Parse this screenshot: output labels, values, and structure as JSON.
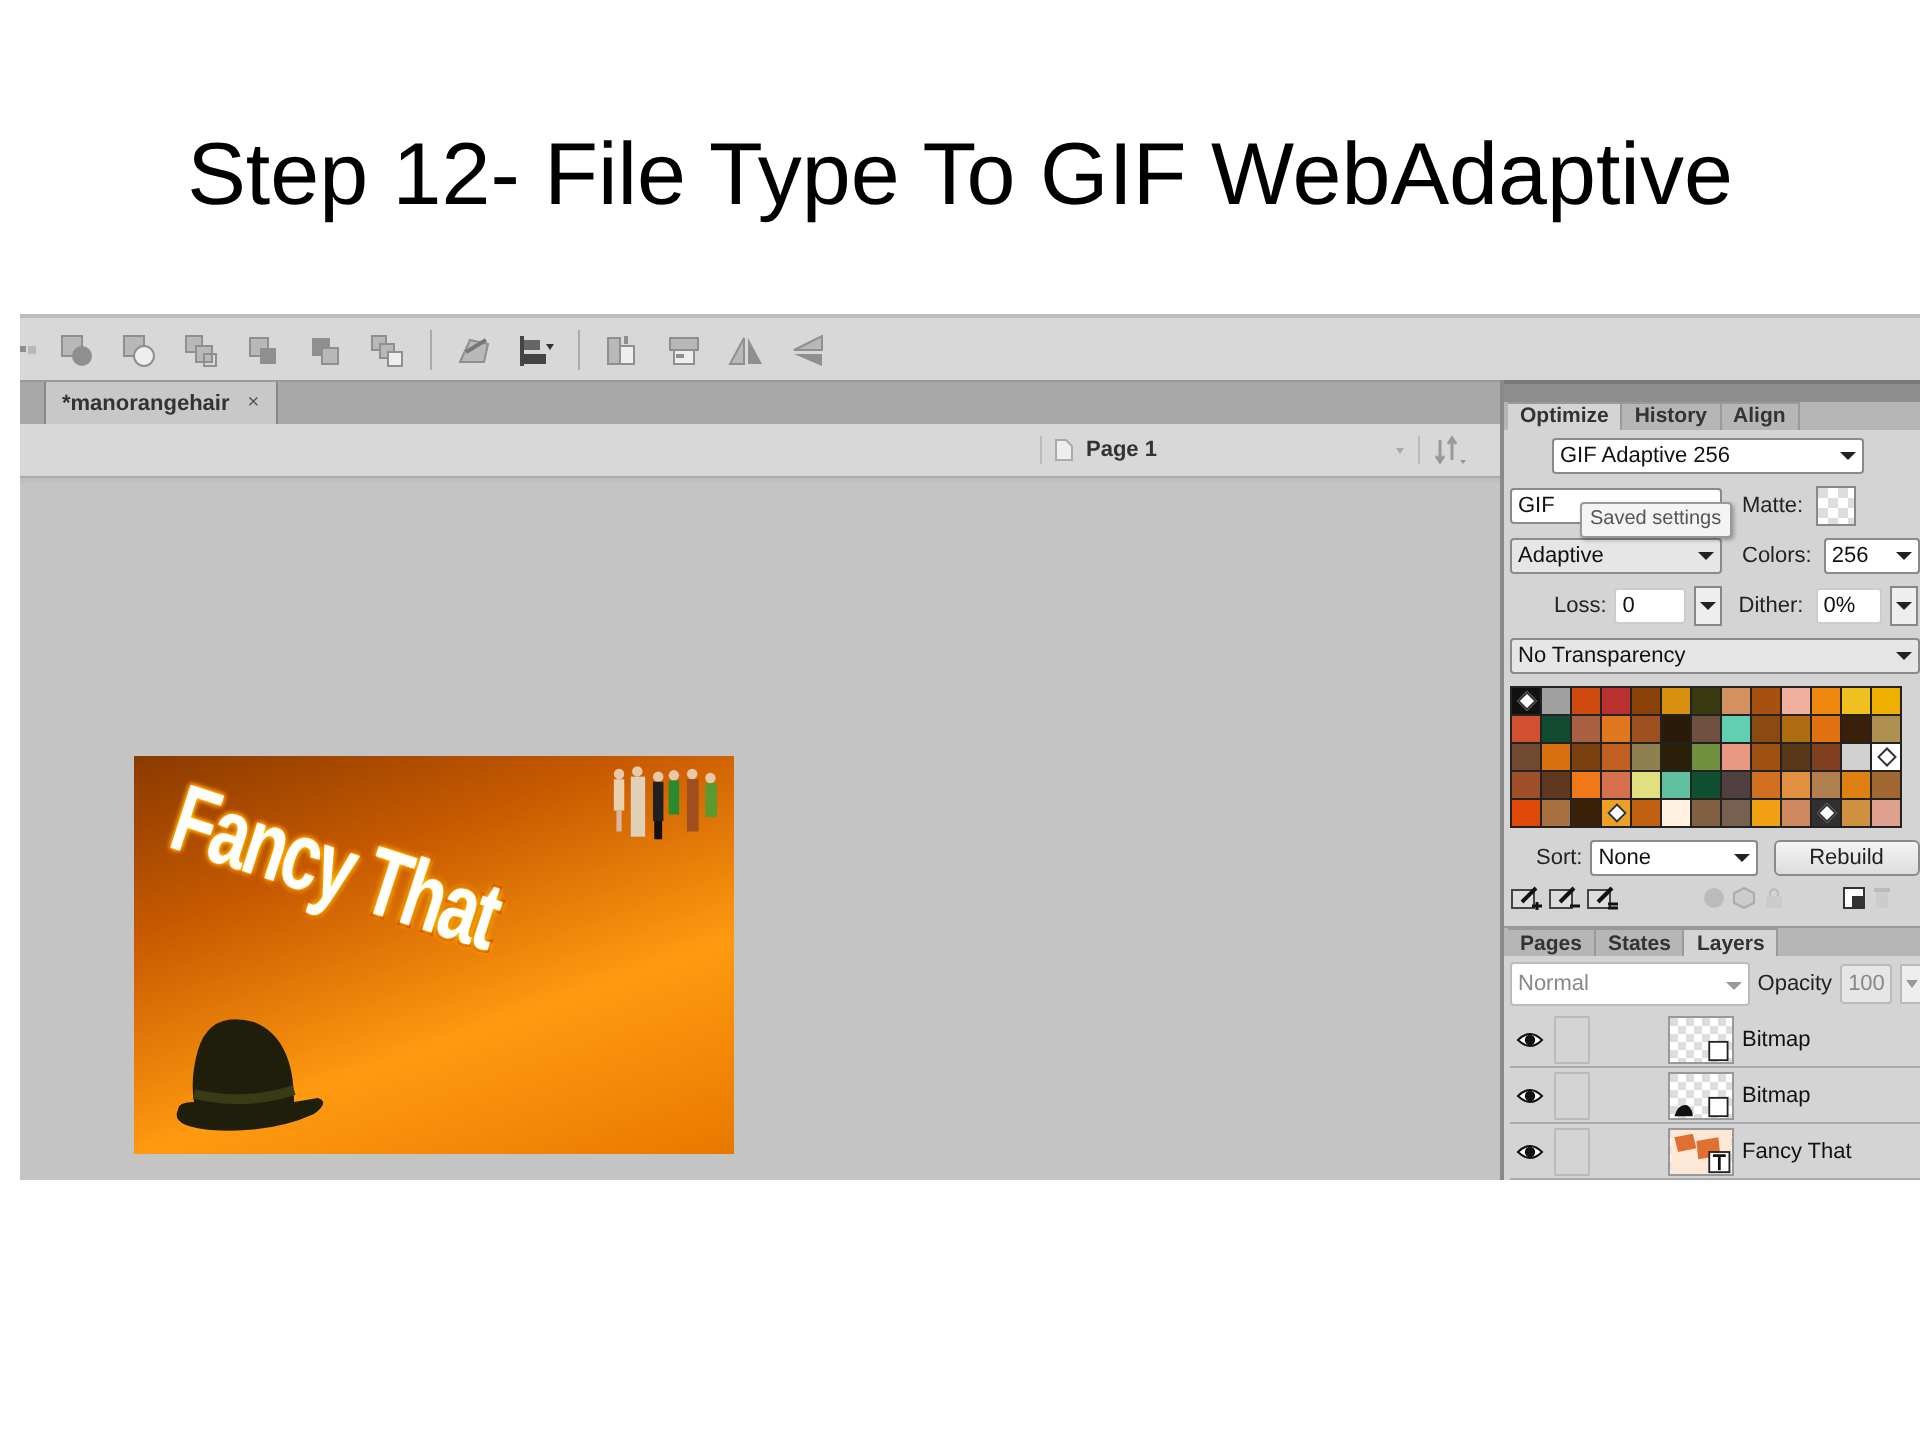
{
  "slide_title": "Step 12- File Type To GIF WebAdaptive",
  "document_tabs": [
    {
      "label": "*manorangehair",
      "close": "×",
      "selected": true
    }
  ],
  "page_bar": {
    "page": "Page 1"
  },
  "canvas": {
    "headline": "Fancy That"
  },
  "optimize_panel": {
    "tabs": [
      {
        "label": "Optimize",
        "selected": true
      },
      {
        "label": "History",
        "selected": false
      },
      {
        "label": "Align",
        "selected": false
      }
    ],
    "preset": "GIF Adaptive 256",
    "format": "GIF",
    "matte_label": "Matte:",
    "tooltip": "Saved settings",
    "palette_type": "Adaptive",
    "colors_label": "Colors:",
    "colors_value": "256",
    "loss_label": "Loss:",
    "loss_value": "0",
    "dither_label": "Dither:",
    "dither_value": "0%",
    "transparency": "No Transparency",
    "swatches": [
      [
        {
          "color": "#111111",
          "marked": true
        },
        {
          "color": "#a0a0a0",
          "marked": false
        },
        {
          "color": "#d04a10",
          "marked": false
        },
        {
          "color": "#b83030",
          "marked": false
        },
        {
          "color": "#8a4208",
          "marked": false
        },
        {
          "color": "#d89010",
          "marked": false
        },
        {
          "color": "#3a3a10",
          "marked": false
        },
        {
          "color": "#d49060",
          "marked": false
        },
        {
          "color": "#a85010",
          "marked": false
        },
        {
          "color": "#f0b0a0",
          "marked": false
        },
        {
          "color": "#f08810",
          "marked": false
        },
        {
          "color": "#f0c020",
          "marked": false
        },
        {
          "color": "#f0b000",
          "marked": false
        }
      ],
      [
        {
          "color": "#d05030",
          "marked": false
        },
        {
          "color": "#104a30",
          "marked": false
        },
        {
          "color": "#a86040",
          "marked": false
        },
        {
          "color": "#e07820",
          "marked": false
        },
        {
          "color": "#a05020",
          "marked": false
        },
        {
          "color": "#2a1a08",
          "marked": false
        },
        {
          "color": "#705040",
          "marked": false
        },
        {
          "color": "#60d0b0",
          "marked": false
        },
        {
          "color": "#8a4a10",
          "marked": false
        },
        {
          "color": "#b06a10",
          "marked": false
        },
        {
          "color": "#e07010",
          "marked": false
        },
        {
          "color": "#3a2008",
          "marked": false
        },
        {
          "color": "#b09050",
          "marked": false
        }
      ],
      [
        {
          "color": "#704a30",
          "marked": false
        },
        {
          "color": "#d87010",
          "marked": false
        },
        {
          "color": "#7a4010",
          "marked": false
        },
        {
          "color": "#c06020",
          "marked": false
        },
        {
          "color": "#908050",
          "marked": false
        },
        {
          "color": "#2a2008",
          "marked": false
        },
        {
          "color": "#709040",
          "marked": false
        },
        {
          "color": "#e89880",
          "marked": false
        },
        {
          "color": "#a05010",
          "marked": false
        },
        {
          "color": "#583818",
          "marked": false
        },
        {
          "color": "#804020",
          "marked": false
        },
        {
          "color": "#d0d0d0",
          "marked": false
        },
        {
          "color": "#ffffff",
          "marked": true
        }
      ],
      [
        {
          "color": "#a05028",
          "marked": false
        },
        {
          "color": "#603820",
          "marked": false
        },
        {
          "color": "#f07818",
          "marked": false
        },
        {
          "color": "#d87050",
          "marked": false
        },
        {
          "color": "#e0e080",
          "marked": false
        },
        {
          "color": "#60c0a0",
          "marked": false
        },
        {
          "color": "#105030",
          "marked": false
        },
        {
          "color": "#504040",
          "marked": false
        },
        {
          "color": "#d07020",
          "marked": false
        },
        {
          "color": "#e09040",
          "marked": false
        },
        {
          "color": "#b08050",
          "marked": false
        },
        {
          "color": "#e08010",
          "marked": false
        },
        {
          "color": "#a06830",
          "marked": false
        }
      ],
      [
        {
          "color": "#e04808",
          "marked": false
        },
        {
          "color": "#a87040",
          "marked": false
        },
        {
          "color": "#3a2008",
          "marked": false
        },
        {
          "color": "#f0a020",
          "marked": true
        },
        {
          "color": "#c06010",
          "marked": false
        },
        {
          "color": "#fff0e0",
          "marked": false
        },
        {
          "color": "#806040",
          "marked": false
        },
        {
          "color": "#786050",
          "marked": false
        },
        {
          "color": "#f0a010",
          "marked": false
        },
        {
          "color": "#d08860",
          "marked": false
        },
        {
          "color": "#303030",
          "marked": true
        },
        {
          "color": "#d09040",
          "marked": false
        },
        {
          "color": "#e0a090",
          "marked": false
        }
      ]
    ],
    "sort_label": "Sort:",
    "sort_value": "None",
    "rebuild": "Rebuild"
  },
  "layers_panel": {
    "tabs": [
      {
        "label": "Pages",
        "selected": false
      },
      {
        "label": "States",
        "selected": false
      },
      {
        "label": "Layers",
        "selected": true
      }
    ],
    "blend_mode": "Normal",
    "opacity_label": "Opacity",
    "opacity_value": "100",
    "layers": [
      {
        "name": "Bitmap",
        "visible": true,
        "kind": "blank"
      },
      {
        "name": "Bitmap",
        "visible": true,
        "kind": "hat"
      },
      {
        "name": "Fancy That",
        "visible": true,
        "kind": "text"
      }
    ]
  }
}
